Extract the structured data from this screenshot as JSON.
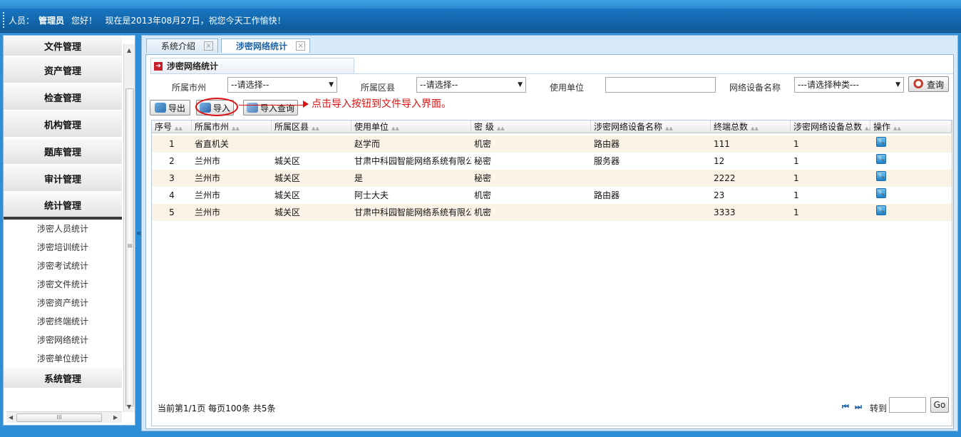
{
  "header": {
    "user_label": "人员：",
    "user_name": "管理员",
    "greeting": "您好！",
    "date_message": "现在是2013年08月27日，祝您今天工作愉快！"
  },
  "sidebar": {
    "sections": [
      {
        "label": "文件管理"
      },
      {
        "label": "资产管理"
      },
      {
        "label": "检查管理"
      },
      {
        "label": "机构管理"
      },
      {
        "label": "题库管理"
      },
      {
        "label": "审计管理"
      },
      {
        "label": "统计管理"
      }
    ],
    "sub_items": [
      {
        "label": "涉密人员统计"
      },
      {
        "label": "涉密培训统计"
      },
      {
        "label": "涉密考试统计"
      },
      {
        "label": "涉密文件统计"
      },
      {
        "label": "涉密资产统计"
      },
      {
        "label": "涉密终端统计"
      },
      {
        "label": "涉密网络统计"
      },
      {
        "label": "涉密单位统计"
      }
    ],
    "last_section": "系统管理",
    "collapse_glyph": "«",
    "scroll_grip": "≡",
    "hscroll_grip": "III"
  },
  "tabs": [
    {
      "label": "系统介绍",
      "close": "×"
    },
    {
      "label": "涉密网络统计",
      "close": "×"
    }
  ],
  "panel": {
    "title": "涉密网络统计",
    "title_icon": "arrow-icon"
  },
  "filters": {
    "city_label": "所属市州",
    "city_value": "--请选择--",
    "county_label": "所属区县",
    "county_value": "--请选择--",
    "unit_label": "使用单位",
    "unit_value": "",
    "device_label": "网络设备名称",
    "device_value": "---请选择种类---",
    "query_button": "查询"
  },
  "toolbar": {
    "export_button": "导出",
    "import_button": "导入",
    "import_query_button": "导入查询"
  },
  "annotation": {
    "text": "点击导入按钮到文件导入界面。",
    "color": "#e01010"
  },
  "grid": {
    "sort_glyph": "▲▲",
    "columns": [
      "序号",
      "所属市州",
      "所属区县",
      "使用单位",
      "密 级",
      "涉密网络设备名称",
      "终端总数",
      "涉密网络设备总数",
      "操作"
    ],
    "rows": [
      {
        "no": "1",
        "city": "省直机关",
        "county": "",
        "unit": "赵学而",
        "level": "机密",
        "device": "路由器",
        "terminals": "111",
        "device_total": "1"
      },
      {
        "no": "2",
        "city": "兰州市",
        "county": "城关区",
        "unit": "甘肃中科园智能网络系统有限公",
        "level": "秘密",
        "device": "服务器",
        "terminals": "12",
        "device_total": "1"
      },
      {
        "no": "3",
        "city": "兰州市",
        "county": "城关区",
        "unit": "是",
        "level": "秘密",
        "device": "",
        "terminals": "2222",
        "device_total": "1"
      },
      {
        "no": "4",
        "city": "兰州市",
        "county": "城关区",
        "unit": "阿士大夫",
        "level": "机密",
        "device": "路由器",
        "terminals": "23",
        "device_total": "1"
      },
      {
        "no": "5",
        "city": "兰州市",
        "county": "城关区",
        "unit": "甘肃中科园智能网络系统有限公",
        "level": "机密",
        "device": "",
        "terminals": "3333",
        "device_total": "1"
      }
    ]
  },
  "pager": {
    "info": "当前第1/1页  每页100条  共5条",
    "first_glyph": "⏮",
    "last_glyph": "⏭",
    "goto_label": "转到",
    "goto_value": "",
    "go_button": "Go"
  }
}
